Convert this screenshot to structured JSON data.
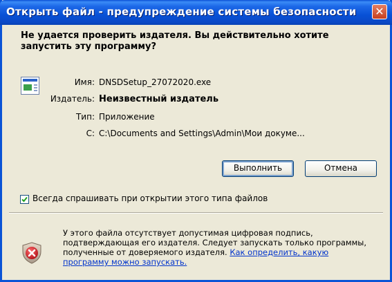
{
  "window": {
    "title": "Открыть файл - предупреждение системы безопасности",
    "close_glyph": "✕"
  },
  "question": "Не удается проверить издателя.  Вы действительно хотите запустить эту программу?",
  "details": {
    "name_label": "Имя:",
    "name_value": "DNSDSetup_27072020.exe",
    "publisher_label": "Издатель:",
    "publisher_value": "Неизвестный издатель",
    "type_label": "Тип:",
    "type_value": "Приложение",
    "from_label": "С:",
    "from_value": "C:\\Documents and Settings\\Admin\\Мои докуме..."
  },
  "buttons": {
    "run": "Выполнить",
    "cancel": "Отмена"
  },
  "checkbox": {
    "checked": true,
    "label": "Всегда спрашивать при открытии этого типа файлов"
  },
  "warning": {
    "text": "У этого файла отсутствует допустимая цифровая подпись, подтверждающая его издателя. Следует запускать только программы, полученные от доверяемого издателя. ",
    "link": "Как определить, какую программу можно запускать."
  },
  "icons": {
    "app": "application-icon",
    "shield": "security-shield-icon"
  },
  "colors": {
    "titlebar": "#0a53d6",
    "face": "#ece9d8",
    "link": "#0033cc",
    "shield_red": "#c8141c"
  }
}
